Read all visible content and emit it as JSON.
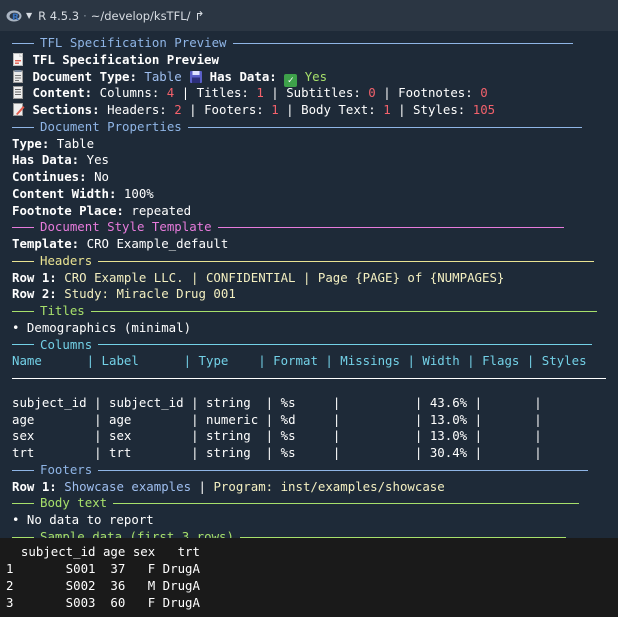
{
  "titlebar": {
    "r_version": "R 4.5.3",
    "separator": "·",
    "path": "~/develop/ksTFL/"
  },
  "console": {
    "title_rule": "TFL Specification Preview",
    "title_line": "TFL Specification Preview",
    "doctype_label": "Document Type:",
    "doctype_value": "Table",
    "hasdata_label": "Has Data:",
    "hasdata_value": "Yes",
    "content_label": "Content:",
    "columns_label": "Columns:",
    "columns_value": "4",
    "titles_label": "Titles:",
    "titles_value": "1",
    "subtitles_label": "Subtitles:",
    "subtitles_value": "0",
    "footnotes_label": "Footnotes:",
    "footnotes_value": "0",
    "sections_label": "Sections:",
    "headers_label": "Headers:",
    "headers_value": "2",
    "footers_label": "Footers:",
    "footers_value": "1",
    "bodytext_label": "Body Text:",
    "bodytext_value": "1",
    "styles_label": "Styles:",
    "styles_value": "105",
    "docprops_rule": "Document Properties",
    "props": [
      {
        "label": "Type:",
        "value": "Table"
      },
      {
        "label": "Has Data:",
        "value": "Yes"
      },
      {
        "label": "Continues:",
        "value": "No"
      },
      {
        "label": "Content Width:",
        "value": "100%"
      },
      {
        "label": "Footnote Place:",
        "value": "repeated"
      }
    ],
    "style_rule": "Document Style Template",
    "template_label": "Template:",
    "template_value": "CRO Example_default",
    "headers_rule": "Headers",
    "header_rows": [
      {
        "label": "Row 1:",
        "value": "CRO Example LLC. | CONFIDENTIAL | Page {PAGE} of {NUMPAGES}"
      },
      {
        "label": "Row 2:",
        "value": "Study: Miracle Drug 001"
      }
    ],
    "titles_rule": "Titles",
    "titles": [
      "• Demographics (minimal)"
    ],
    "columns_rule": "Columns",
    "col_headers": [
      "Name",
      "Label",
      "Type",
      "Format",
      "Missings",
      "Width",
      "Flags",
      "Styles"
    ],
    "col_rows": [
      {
        "name": "subject_id",
        "label": "subject_id",
        "type": "string",
        "format": "%s",
        "missings": "",
        "width": "43.6%",
        "flags": "",
        "styles": ""
      },
      {
        "name": "age",
        "label": "age",
        "type": "numeric",
        "format": "%d",
        "missings": "",
        "width": "13.0%",
        "flags": "",
        "styles": ""
      },
      {
        "name": "sex",
        "label": "sex",
        "type": "string",
        "format": "%s",
        "missings": "",
        "width": "13.0%",
        "flags": "",
        "styles": ""
      },
      {
        "name": "trt",
        "label": "trt",
        "type": "string",
        "format": "%s",
        "missings": "",
        "width": "30.4%",
        "flags": "",
        "styles": ""
      }
    ],
    "footers_rule": "Footers",
    "footer_rows": [
      {
        "label": "Row 1:",
        "value": "Showcase examples",
        "value2": "Program: inst/examples/showcase"
      }
    ],
    "body_rule": "Body text",
    "body_items": [
      "• No data to report"
    ],
    "sample_rule": "Sample data (first 3 rows)"
  },
  "sample": {
    "header": "  subject_id age sex   trt",
    "rows": [
      "1       S001  37   F DrugA",
      "2       S002  36   M DrugA",
      "3       S003  60   F DrugA"
    ]
  },
  "colors": {
    "background": "#1e2a38",
    "rule_blue": "#8fb5e6",
    "rule_pink": "#e77bdc",
    "rule_yellow": "#e9e392",
    "rule_green": "#a7e06b",
    "rule_cyan": "#73d1e7",
    "number_red": "#f2616b"
  }
}
